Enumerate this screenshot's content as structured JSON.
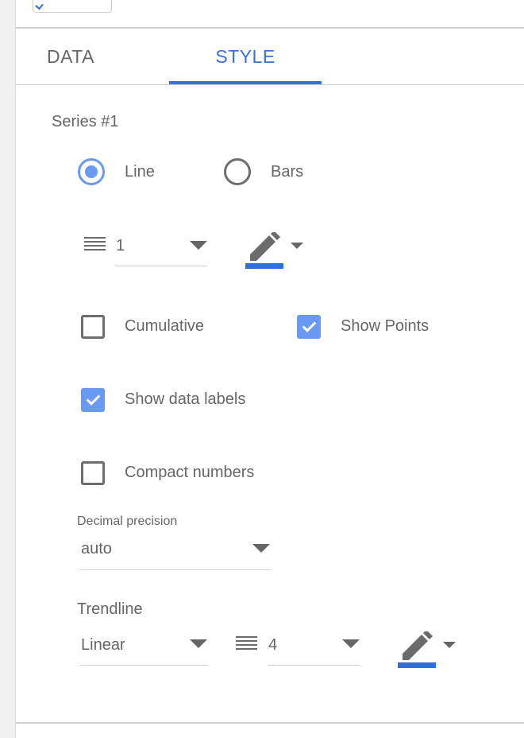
{
  "tabs": [
    {
      "label": "DATA",
      "active": false
    },
    {
      "label": "STYLE",
      "active": true
    }
  ],
  "series": {
    "title": "Series #1",
    "chart_types": [
      {
        "label": "Line",
        "selected": true
      },
      {
        "label": "Bars",
        "selected": false
      }
    ],
    "line_weight": "1",
    "line_color": "#2f6fdc",
    "options": {
      "cumulative": {
        "label": "Cumulative",
        "checked": false
      },
      "show_points": {
        "label": "Show Points",
        "checked": true
      },
      "show_data_labels": {
        "label": "Show data labels",
        "checked": true
      },
      "compact_numbers": {
        "label": "Compact numbers",
        "checked": false
      }
    },
    "decimal_precision": {
      "label": "Decimal precision",
      "value": "auto"
    },
    "trendline": {
      "label": "Trendline",
      "type": "Linear",
      "weight": "4",
      "color": "#2f6fdc"
    }
  },
  "colors": {
    "accent": "#3b6fd9",
    "checkbox": "#6a99f2"
  },
  "icons": [
    "line-weight-icon",
    "pencil-icon",
    "chevron-down-icon"
  ]
}
